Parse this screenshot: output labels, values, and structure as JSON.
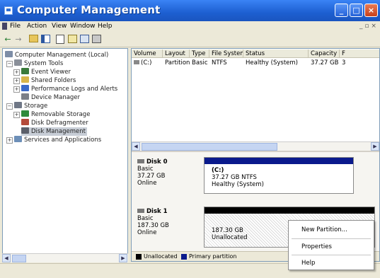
{
  "window": {
    "title": "Computer Management",
    "controls": {
      "minimize": "_",
      "maximize": "□",
      "close": "×"
    }
  },
  "menu": {
    "items": [
      "File",
      "Action",
      "View",
      "Window",
      "Help"
    ],
    "right_control": "_ ▫ ×"
  },
  "tree": {
    "root": "Computer Management (Local)",
    "system_tools": "System Tools",
    "event_viewer": "Event Viewer",
    "shared_folders": "Shared Folders",
    "perf_logs": "Performance Logs and Alerts",
    "device_manager": "Device Manager",
    "storage": "Storage",
    "removable": "Removable Storage",
    "defrag": "Disk Defragmenter",
    "disk_mgmt": "Disk Management",
    "services": "Services and Applications"
  },
  "volumes": {
    "headers": [
      "Volume",
      "Layout",
      "Type",
      "File System",
      "Status",
      "Capacity",
      "F"
    ],
    "rows": [
      [
        "(C:)",
        "Partition",
        "Basic",
        "NTFS",
        "Healthy (System)",
        "37.27 GB",
        "3"
      ]
    ]
  },
  "disks": [
    {
      "name": "Disk 0",
      "type": "Basic",
      "size": "37.27 GB",
      "status": "Online",
      "partition_label": "(C:)",
      "partition_size": "37.27 GB NTFS",
      "partition_status": "Healthy (System)",
      "bar_color": "#0a1a8c"
    },
    {
      "name": "Disk 1",
      "type": "Basic",
      "size": "187.30 GB",
      "status": "Online",
      "partition_size": "187.30 GB",
      "partition_status": "Unallocated",
      "bar_color": "#000000"
    }
  ],
  "legend": [
    {
      "label": "Unallocated",
      "color": "#000000"
    },
    {
      "label": "Primary partition",
      "color": "#0a1a8c"
    }
  ],
  "context_menu": {
    "items": [
      "New Partition...",
      "Properties",
      "Help"
    ]
  },
  "icons": {
    "back": "back-icon",
    "forward": "forward-icon"
  }
}
